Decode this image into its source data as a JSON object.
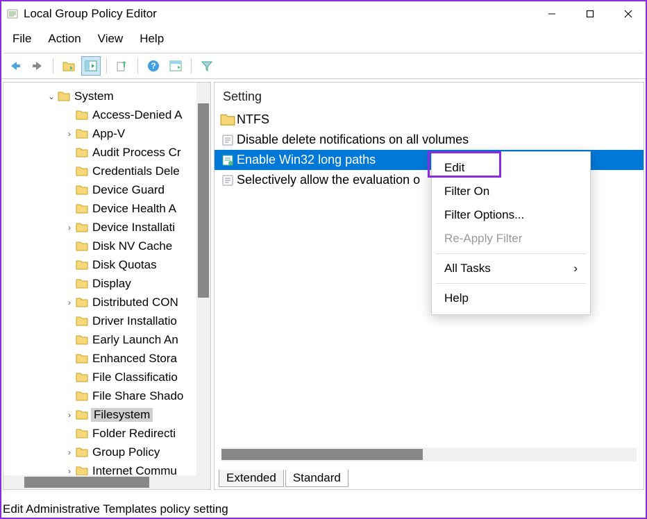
{
  "title": "Local Group Policy Editor",
  "menu": {
    "file": "File",
    "action": "Action",
    "view": "View",
    "help": "Help"
  },
  "tree": {
    "root": "System",
    "items": [
      {
        "label": "Access-Denied A",
        "exp": ""
      },
      {
        "label": "App-V",
        "exp": "›"
      },
      {
        "label": "Audit Process Cr",
        "exp": ""
      },
      {
        "label": "Credentials Dele",
        "exp": ""
      },
      {
        "label": "Device Guard",
        "exp": ""
      },
      {
        "label": "Device Health A",
        "exp": ""
      },
      {
        "label": "Device Installati",
        "exp": "›"
      },
      {
        "label": "Disk NV Cache",
        "exp": ""
      },
      {
        "label": "Disk Quotas",
        "exp": ""
      },
      {
        "label": "Display",
        "exp": ""
      },
      {
        "label": "Distributed CON",
        "exp": "›"
      },
      {
        "label": "Driver Installatio",
        "exp": ""
      },
      {
        "label": "Early Launch An",
        "exp": ""
      },
      {
        "label": "Enhanced Stora",
        "exp": ""
      },
      {
        "label": "File Classificatio",
        "exp": ""
      },
      {
        "label": "File Share Shado",
        "exp": ""
      },
      {
        "label": "Filesystem",
        "exp": "›",
        "selected": true
      },
      {
        "label": "Folder Redirecti",
        "exp": ""
      },
      {
        "label": "Group Policy",
        "exp": "›"
      },
      {
        "label": "Internet Commu",
        "exp": "›"
      }
    ]
  },
  "list": {
    "header": "Setting",
    "rows": [
      {
        "label": "NTFS",
        "icon": "folder"
      },
      {
        "label": "Disable delete notifications on all volumes",
        "icon": "setting"
      },
      {
        "label": "Enable Win32 long paths",
        "icon": "setting",
        "selected": true
      },
      {
        "label": "Selectively allow the evaluation o",
        "icon": "setting"
      }
    ]
  },
  "tabs": {
    "extended": "Extended",
    "standard": "Standard"
  },
  "context_menu": {
    "items": [
      {
        "label": "Edit",
        "highlight": true
      },
      {
        "label": "Filter On"
      },
      {
        "label": "Filter Options..."
      },
      {
        "label": "Re-Apply Filter",
        "disabled": true
      },
      {
        "sep": true
      },
      {
        "label": "All Tasks",
        "sub": true
      },
      {
        "sep": true
      },
      {
        "label": "Help"
      }
    ]
  },
  "status": "Edit Administrative Templates policy setting"
}
